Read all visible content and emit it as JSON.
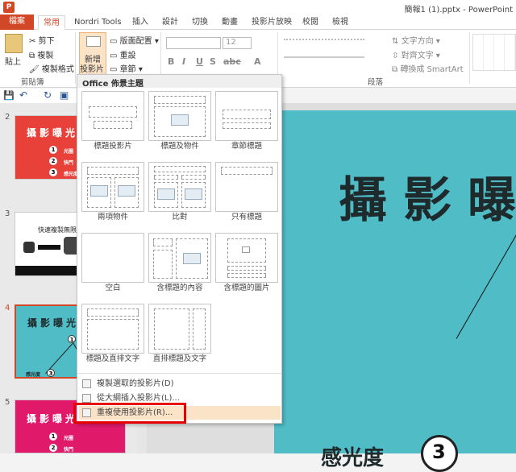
{
  "app_badge": "P",
  "window_title": "簡報1 (1).pptx - PowerPoint",
  "tabs": [
    "檔案",
    "常用",
    "Nordri Tools",
    "插入",
    "設計",
    "切換",
    "動畫",
    "投影片放映",
    "校閱",
    "檢視"
  ],
  "clipboard": {
    "paste": "貼上",
    "cut": "剪下",
    "copy": "複製",
    "format_painter": "複製格式",
    "group": "剪貼簿"
  },
  "slides_group": {
    "new_slide_line1": "新增",
    "new_slide_line2": "投影片",
    "layout": "版面配置",
    "reset": "重設",
    "section": "章節"
  },
  "font": {
    "size": "12"
  },
  "paragraph": {
    "text_direction": "文字方向",
    "align_text": "對齊文字",
    "smartart": "轉換成 SmartArt",
    "group": "段落"
  },
  "layout_menu": {
    "header": "Office 佈景主題",
    "layouts": [
      "標題投影片",
      "標題及物件",
      "章節標題",
      "兩項物件",
      "比對",
      "只有標題",
      "空白",
      "含標題的內容",
      "含標題的圖片",
      "標題及直排文字",
      "直排標題及文字"
    ],
    "items": [
      "複製選取的投影片(D)",
      "從大綱插入投影片(L)...",
      "重複使用投影片(R)..."
    ]
  },
  "thumbnails": {
    "numbers": [
      "2",
      "3",
      "4",
      "5"
    ],
    "s2_title": "攝影曝光",
    "s2_bullets": [
      "光圈",
      "快門",
      "感光度"
    ],
    "s3_title": "快速複製無限",
    "s4_title": "攝影曝光",
    "s4_label": "感光度",
    "s5_title": "攝影曝光",
    "s5_bullets": [
      "光圈",
      "快門"
    ]
  },
  "main_slide": {
    "title": "攝影曝",
    "label": "感光度",
    "badge": "3"
  },
  "colors": {
    "accent": "#d24726",
    "slide_teal": "#4fbcc6",
    "slide_red": "#e8413a",
    "slide_pink": "#e0196b",
    "highlight": "#e60000"
  }
}
